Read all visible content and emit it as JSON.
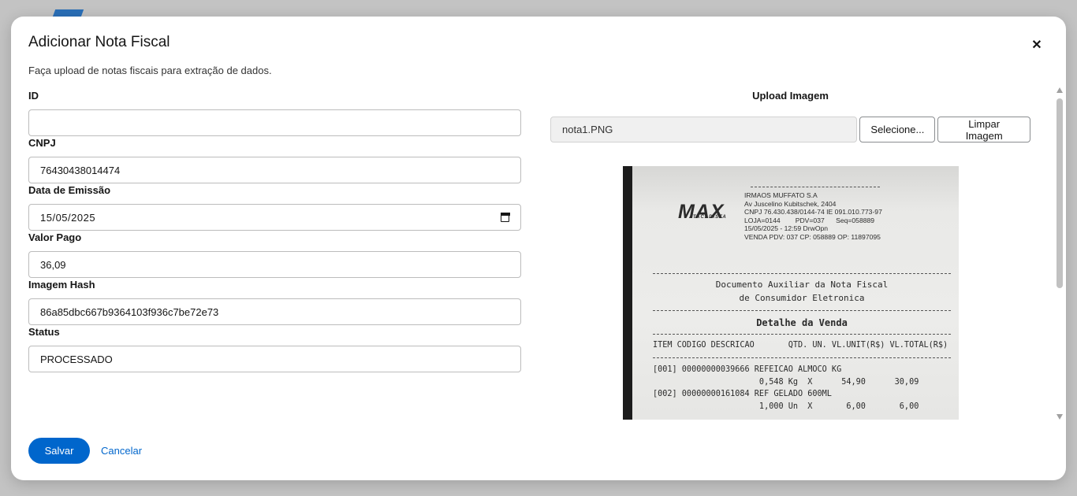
{
  "modal": {
    "title": "Adicionar Nota Fiscal",
    "description": "Faça upload de notas fiscais para extração de dados.",
    "close_icon": "close-icon"
  },
  "form": {
    "fields": [
      {
        "label": "ID",
        "value": ""
      },
      {
        "label": "CNPJ",
        "value": "76430438014474"
      },
      {
        "label": "Data de Emissão",
        "value": "15/05/2025"
      },
      {
        "label": "Valor Pago",
        "value": "36,09"
      },
      {
        "label": "Imagem Hash",
        "value": "86a85dbc667b9364103f936c7be72e73"
      },
      {
        "label": "Status",
        "value": "PROCESSADO"
      }
    ]
  },
  "upload": {
    "title": "Upload Imagem",
    "file_name": "nota1.PNG",
    "select_label": "Selecione...",
    "clear_label": "Limpar Imagem"
  },
  "receipt": {
    "logo": "MAX",
    "logo_sub": "ATACADISTA",
    "store_lines": [
      "IRMAOS MUFFATO S.A",
      "Av Juscelino Kubitschek, 2404",
      "CNPJ 76.430.438/0144-74 IE 091.010.773-97",
      "LOJA=0144        PDV=037      Seq=058889",
      "15/05/2025 - 12:59  DrwOpn",
      "VENDA PDV: 037 CP: 058889 OP: 11897095"
    ],
    "doc_title_1": "Documento Auxiliar da Nota Fiscal",
    "doc_title_2": "de Consumidor Eletronica",
    "section": "Detalhe da Venda",
    "header": "ITEM CODIGO DESCRICAO       QTD. UN. VL.UNIT(R$) VL.TOTAL(R$)",
    "items": [
      "[001] 00000000039666 REFEICAO ALMOCO KG",
      "                      0,548 Kg  X      54,90      30,09",
      "[002] 00000000161084 REF GELADO 600ML",
      "                      1,000 Un  X       6,00       6,00"
    ]
  },
  "footer": {
    "save_label": "Salvar",
    "cancel_label": "Cancelar"
  },
  "colors": {
    "primary": "#0066cc",
    "backdrop": "#c3c3c3"
  }
}
